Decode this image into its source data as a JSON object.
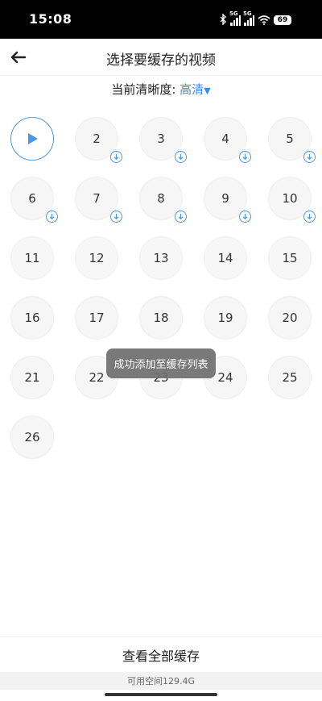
{
  "status_bar": {
    "time": "15:08",
    "network_1": "5G",
    "network_2": "5G",
    "battery": "69"
  },
  "nav": {
    "back_icon": "arrow-left-icon",
    "title": "选择要缓存的视频"
  },
  "quality": {
    "label": "当前清晰度:",
    "value": "高清",
    "dropdown_icon": "▼"
  },
  "episodes": [
    {
      "label": "",
      "state": "playing"
    },
    {
      "label": "2",
      "state": "downloading"
    },
    {
      "label": "3",
      "state": "downloading"
    },
    {
      "label": "4",
      "state": "downloading"
    },
    {
      "label": "5",
      "state": "downloading"
    },
    {
      "label": "6",
      "state": "downloading"
    },
    {
      "label": "7",
      "state": "downloading"
    },
    {
      "label": "8",
      "state": "downloading"
    },
    {
      "label": "9",
      "state": "downloading"
    },
    {
      "label": "10",
      "state": "downloading"
    },
    {
      "label": "11",
      "state": "none"
    },
    {
      "label": "12",
      "state": "none"
    },
    {
      "label": "13",
      "state": "none"
    },
    {
      "label": "14",
      "state": "none"
    },
    {
      "label": "15",
      "state": "none"
    },
    {
      "label": "16",
      "state": "none"
    },
    {
      "label": "17",
      "state": "none"
    },
    {
      "label": "18",
      "state": "none"
    },
    {
      "label": "19",
      "state": "none"
    },
    {
      "label": "20",
      "state": "none"
    },
    {
      "label": "21",
      "state": "none"
    },
    {
      "label": "22",
      "state": "none"
    },
    {
      "label": "23",
      "state": "none"
    },
    {
      "label": "24",
      "state": "none"
    },
    {
      "label": "25",
      "state": "none"
    },
    {
      "label": "26",
      "state": "none"
    }
  ],
  "toast": "成功添加至缓存列表",
  "bottom": {
    "view_all": "查看全部缓存",
    "storage": "可用空间129.4G"
  },
  "colors": {
    "accent": "#3b8fe8",
    "toast_bg": "#6e6e6e"
  }
}
